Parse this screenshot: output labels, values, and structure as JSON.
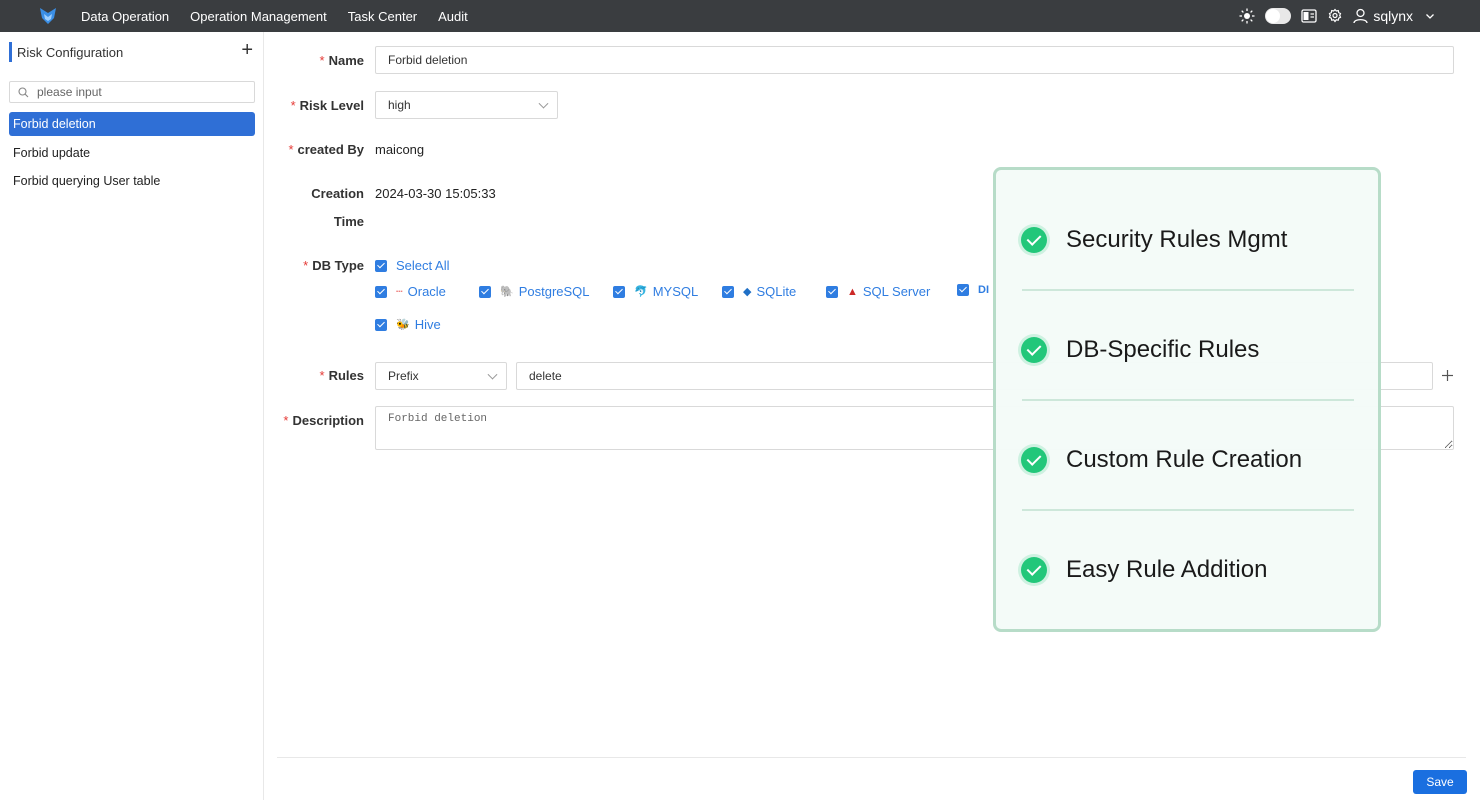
{
  "topbar": {
    "nav": [
      "Data Operation",
      "Operation Management",
      "Task Center",
      "Audit"
    ],
    "username": "sqlynx"
  },
  "sidebar": {
    "title": "Risk Configuration",
    "search_placeholder": "please input",
    "items": [
      {
        "label": "Forbid deletion",
        "active": true
      },
      {
        "label": "Forbid update",
        "active": false
      },
      {
        "label": "Forbid querying User table",
        "active": false
      }
    ]
  },
  "form": {
    "name_label": "Name",
    "name_value": "Forbid deletion",
    "risk_label": "Risk Level",
    "risk_value": "high",
    "created_by_label": "created By",
    "created_by_value": "maicong",
    "creation_label_1": "Creation",
    "creation_label_2": "Time",
    "creation_value": "2024-03-30 15:05:33",
    "db_type_label": "DB Type",
    "select_all": "Select All",
    "db_types": [
      "Oracle",
      "PostgreSQL",
      "MYSQL",
      "SQLite",
      "SQL Server",
      "Hive"
    ],
    "rules_label": "Rules",
    "rule_type": "Prefix",
    "rule_value": "delete",
    "description_label": "Description",
    "description_placeholder": "Forbid deletion",
    "save_label": "Save"
  },
  "overlay": {
    "features": [
      "Security Rules Mgmt",
      "DB-Specific Rules",
      "Custom Rule Creation",
      "Easy Rule Addition"
    ]
  },
  "colors": {
    "topbar": "#3a3d40",
    "accent": "#2f6fd6",
    "save": "#1a6fe0",
    "check": "#22c77a"
  }
}
